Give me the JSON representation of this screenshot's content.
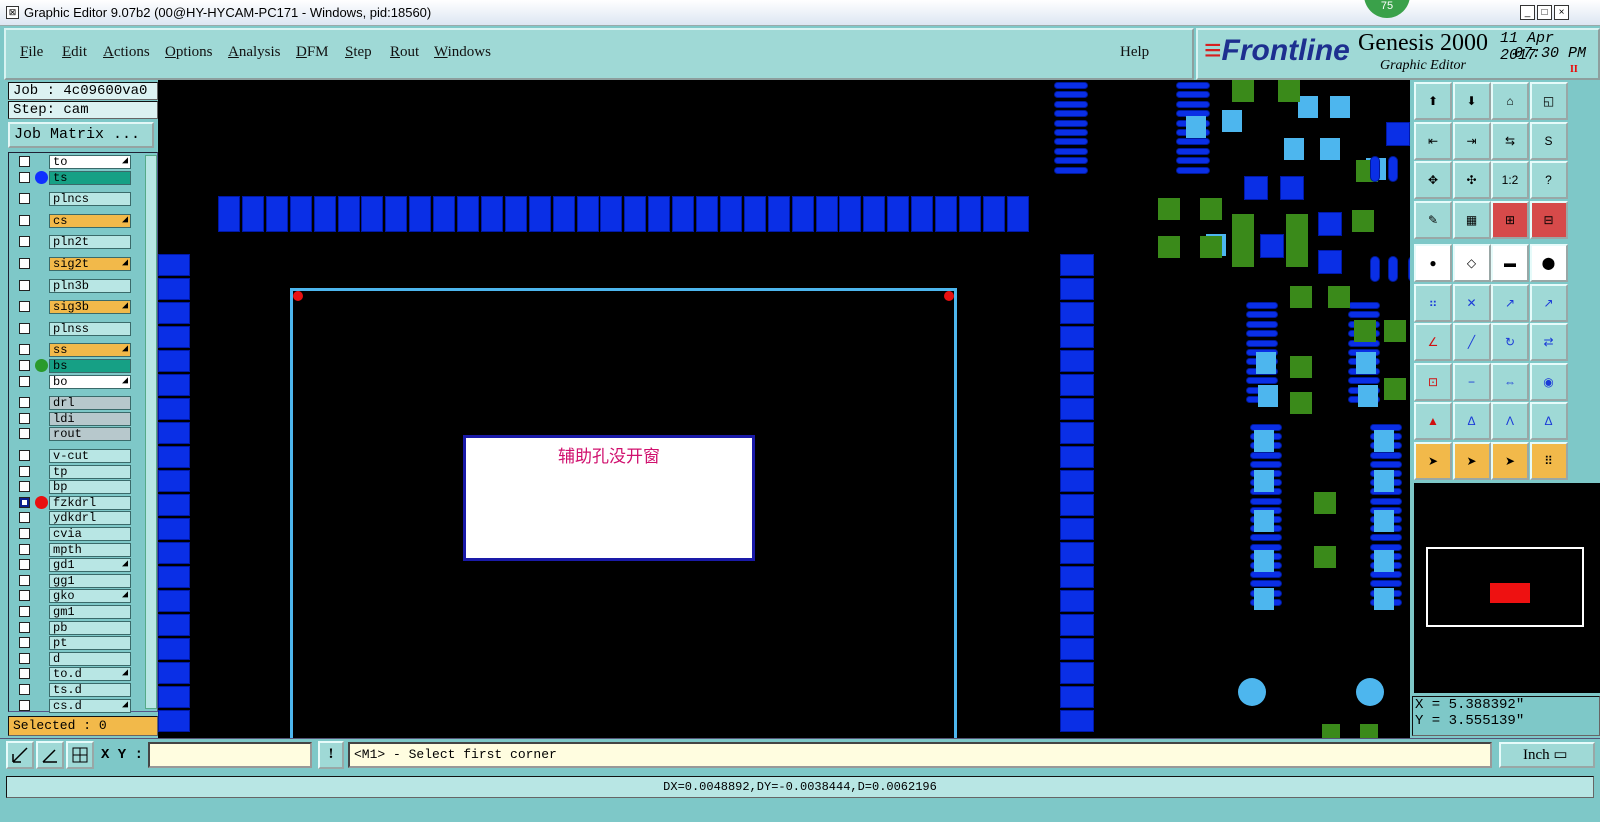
{
  "window": {
    "title": "Graphic Editor 9.07b2 (00@HY-HYCAM-PC171 - Windows, pid:18560)",
    "badge": "75",
    "minimize": "_",
    "maximize": "□",
    "close": "×"
  },
  "menu": {
    "items": [
      {
        "u": "F",
        "rest": "ile"
      },
      {
        "u": "E",
        "rest": "dit"
      },
      {
        "u": "A",
        "rest": "ctions"
      },
      {
        "u": "O",
        "rest": "ptions"
      },
      {
        "u": "A",
        "rest": "nalysis"
      },
      {
        "u": "D",
        "rest": "FM"
      },
      {
        "u": "S",
        "rest": "tep"
      },
      {
        "u": "R",
        "rest": "out"
      },
      {
        "u": "W",
        "rest": "indows"
      }
    ],
    "help": "Help"
  },
  "brand": {
    "logo": "Frontline",
    "product": "Genesis 2000",
    "subtitle": "Graphic Editor",
    "date": "11 Apr 2017",
    "time": "07:30 PM",
    "record": "II"
  },
  "sidebar": {
    "job": "Job : 4c09600va0",
    "step": "Step: cam",
    "job_matrix": "Job Matrix ...",
    "selected": "Selected : 0",
    "layers": [
      {
        "name": "to",
        "style": "white",
        "mark": true
      },
      {
        "name": "ts",
        "style": "green",
        "dot": "#1030ff"
      },
      {
        "name": "plncs",
        "style": ""
      },
      {
        "name": "cs",
        "style": "orange",
        "mark": true
      },
      {
        "name": "pln2t",
        "style": ""
      },
      {
        "name": "sig2t",
        "style": "orange",
        "mark": true
      },
      {
        "name": "pln3b",
        "style": ""
      },
      {
        "name": "sig3b",
        "style": "orange",
        "mark": true
      },
      {
        "name": "plnss",
        "style": ""
      },
      {
        "name": "ss",
        "style": "orange",
        "mark": true
      },
      {
        "name": "bs",
        "style": "green",
        "dot": "#2a9a2a"
      },
      {
        "name": "bo",
        "style": "white",
        "mark": true
      },
      {
        "name": "drl",
        "style": "gray"
      },
      {
        "name": "ldi",
        "style": "gray"
      },
      {
        "name": "rout",
        "style": "gray"
      },
      {
        "name": "v-cut",
        "style": ""
      },
      {
        "name": "tp",
        "style": ""
      },
      {
        "name": "bp",
        "style": ""
      },
      {
        "name": "fzkdrl",
        "style": "",
        "dot": "#e81010",
        "active": true
      },
      {
        "name": "ydkdrl",
        "style": ""
      },
      {
        "name": "cvia",
        "style": ""
      },
      {
        "name": "mpth",
        "style": ""
      },
      {
        "name": "gd1",
        "style": "",
        "mark": true
      },
      {
        "name": "gg1",
        "style": ""
      },
      {
        "name": "gko",
        "style": "",
        "mark": true
      },
      {
        "name": "gm1",
        "style": ""
      },
      {
        "name": "pb",
        "style": ""
      },
      {
        "name": "pt",
        "style": ""
      },
      {
        "name": "d",
        "style": ""
      },
      {
        "name": "to.d",
        "style": "",
        "mark": true
      },
      {
        "name": "ts.d",
        "style": ""
      },
      {
        "name": "cs.d",
        "style": "",
        "mark": true
      }
    ]
  },
  "canvas": {
    "note": "辅助孔没开窗"
  },
  "toolbox": {
    "tools": [
      "open-icon",
      "save-icon",
      "home-icon",
      "zoom-window-icon",
      "move-left-icon",
      "move-right-icon",
      "swap-icon",
      "text-icon",
      "fit-icon",
      "center-icon",
      "scale-1-2-icon",
      "question-icon",
      "palette-icon",
      "grid-icon",
      "measure-icon",
      "snap-icon",
      "record-icon",
      "transform-icon",
      "ruler-icon",
      "circle-icon",
      "connect-icon",
      "cross-icon",
      "point-icon",
      "point-arrow-icon",
      "line-icon",
      "arc-icon",
      "rotate-icon",
      "flip-icon",
      "edit-icon",
      "minus-icon",
      "resize-icon",
      "group-icon",
      "pad-icon",
      "net-icon",
      "highlight-icon",
      "route-icon",
      "select-icon",
      "select-box-icon",
      "select-poly-icon",
      "select-net-icon"
    ],
    "scale_label": "1:2"
  },
  "readout": {
    "x": "X = 5.388392\"",
    "y": "Y = 3.555139\""
  },
  "command": {
    "xy_label": "X Y :",
    "xy_value": "",
    "alert": "!",
    "prompt": "<M1> - Select first corner",
    "units": "Inch"
  },
  "status": {
    "text": "DX=0.0048892,DY=-0.0038444,D=0.0062196"
  }
}
